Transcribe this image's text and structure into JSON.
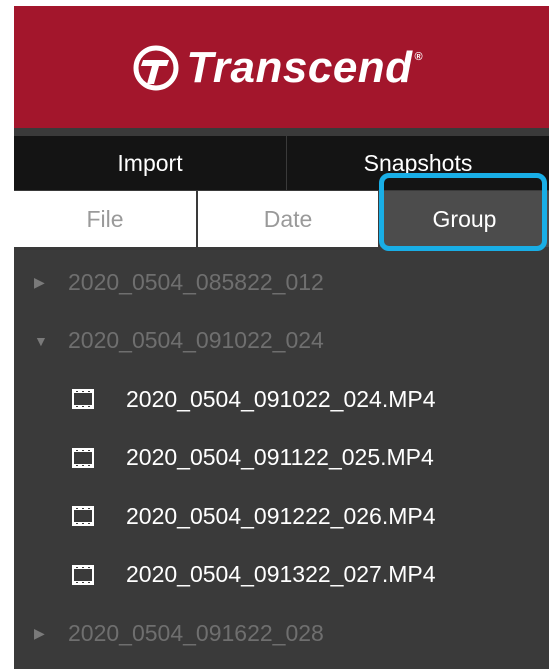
{
  "brand": {
    "name": "Transcend",
    "registered": "®",
    "logo_icon": "transcend-t-logo",
    "color": "#a3162c"
  },
  "tabs": [
    {
      "label": "Import",
      "active": false
    },
    {
      "label": "Snapshots",
      "active": false
    }
  ],
  "view_modes": [
    {
      "label": "File",
      "active": false
    },
    {
      "label": "Date",
      "active": false
    },
    {
      "label": "Group",
      "active": true
    }
  ],
  "highlight_color": "#19aee6",
  "groups": [
    {
      "name": "2020_0504_085822_012",
      "expanded": false,
      "caret_icon": "caret-right-icon",
      "files": []
    },
    {
      "name": "2020_0504_091022_024",
      "expanded": true,
      "caret_icon": "caret-down-icon",
      "files": [
        {
          "name": "2020_0504_091022_024.MP4",
          "icon": "film-icon"
        },
        {
          "name": "2020_0504_091122_025.MP4",
          "icon": "film-icon"
        },
        {
          "name": "2020_0504_091222_026.MP4",
          "icon": "film-icon"
        },
        {
          "name": "2020_0504_091322_027.MP4",
          "icon": "film-icon"
        }
      ]
    },
    {
      "name": "2020_0504_091622_028",
      "expanded": false,
      "caret_icon": "caret-right-icon",
      "files": []
    }
  ],
  "carets": {
    "collapsed": "▶",
    "expanded": "▼"
  }
}
